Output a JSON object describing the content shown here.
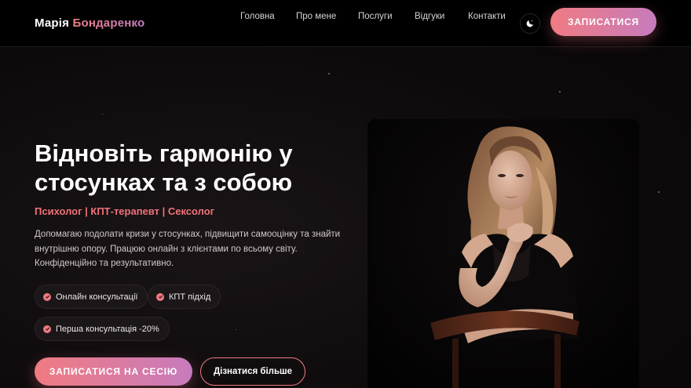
{
  "header": {
    "logo_first": "Марія",
    "logo_last": "Бондаренко",
    "nav": [
      {
        "label": "Головна"
      },
      {
        "label": "Про мене"
      },
      {
        "label": "Послуги"
      },
      {
        "label": "Відгуки"
      },
      {
        "label": "Контакти"
      }
    ],
    "theme_icon": "moon-icon",
    "cta_label": "ЗАПИСАТИСЯ"
  },
  "hero": {
    "title_line1": "Відновіть гармонію у",
    "title_line2": "стосунках та з собою",
    "subtitle": "Психолог | КПТ-терапевт | Сексолог",
    "desc_line1": "Допомагаю подолати кризи у стосунках, підвищити самооцінку та знайти",
    "desc_line2": "внутрішню опору. Працюю онлайн з клієнтами по всьому світу.",
    "desc_line3": "Конфіденційно та результативно.",
    "features": [
      {
        "label": "Онлайн консультації"
      },
      {
        "label": "КПТ підхід"
      },
      {
        "label": "Перша консультація -20%"
      }
    ],
    "primary_cta": "ЗАПИСАТИСЯ НА СЕСІЮ",
    "secondary_cta": "Дізнатися більше"
  },
  "colors": {
    "accent": "#f07a82",
    "accent_gradient_end": "#c77bbd",
    "background": "#0e0b0c"
  }
}
